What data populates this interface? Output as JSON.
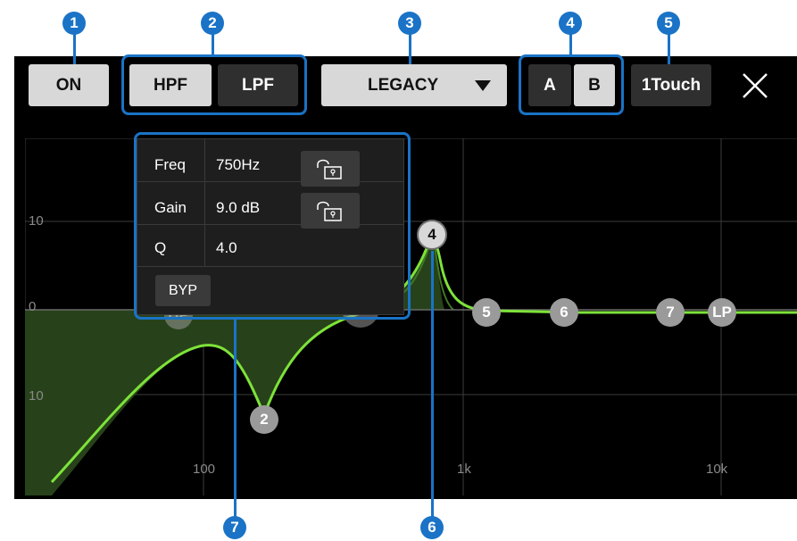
{
  "toolbar": {
    "on_label": "ON",
    "hpf_label": "HPF",
    "lpf_label": "LPF",
    "eq_type": "LEGACY",
    "a_label": "A",
    "b_label": "B",
    "onetouch_label": "1Touch"
  },
  "callouts": [
    "1",
    "2",
    "3",
    "4",
    "5",
    "6",
    "7"
  ],
  "graph": {
    "y_labels": {
      "top": "10",
      "zero": "0",
      "bottom": "10"
    },
    "x_labels": {
      "f100": "100",
      "f1k": "1k",
      "f10k": "10k"
    },
    "nodes": [
      {
        "label": "HP"
      },
      {
        "label": "2"
      },
      {
        "label": "3"
      },
      {
        "label": "4"
      },
      {
        "label": "5"
      },
      {
        "label": "6"
      },
      {
        "label": "7"
      },
      {
        "label": "LP"
      }
    ]
  },
  "popup": {
    "freq_label": "Freq",
    "freq_value": "750Hz",
    "gain_label": "Gain",
    "gain_value": "9.0 dB",
    "q_label": "Q",
    "q_value": "4.0",
    "byp_label": "BYP"
  },
  "colors": {
    "accent": "#1a73c6",
    "curve": "#7ee23a",
    "fill": "#27421a",
    "background": "#000000"
  }
}
